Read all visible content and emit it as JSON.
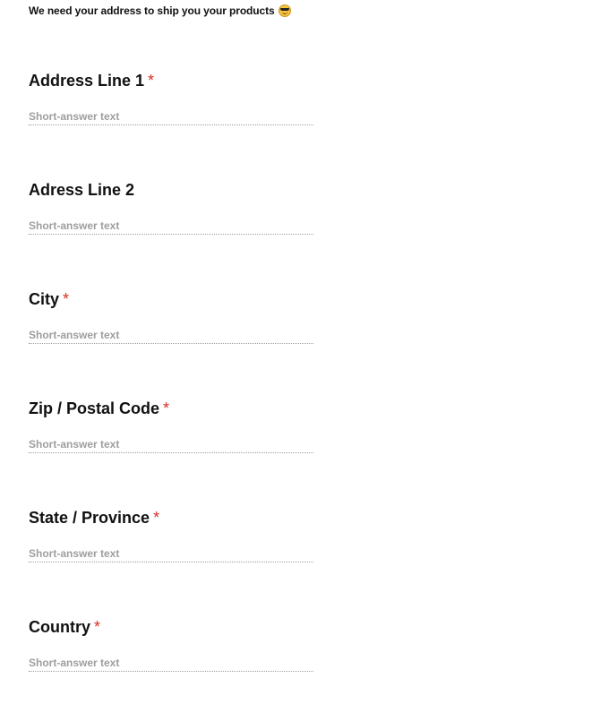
{
  "intro": {
    "text": "We need your address to ship you your products",
    "emoji_icon": "smiling-face-with-sunglasses"
  },
  "questions": [
    {
      "title": "Address Line 1",
      "required": "*",
      "placeholder": "Short-answer text",
      "value": ""
    },
    {
      "title": "Adress Line 2",
      "required": "",
      "placeholder": "Short-answer text",
      "value": ""
    },
    {
      "title": "City",
      "required": "*",
      "placeholder": "Short-answer text",
      "value": ""
    },
    {
      "title": "Zip / Postal Code",
      "required": "*",
      "placeholder": "Short-answer text",
      "value": ""
    },
    {
      "title": "State / Province",
      "required": "*",
      "placeholder": "Short-answer text",
      "value": ""
    },
    {
      "title": "Country",
      "required": "*",
      "placeholder": "Short-answer text",
      "value": ""
    }
  ],
  "colors": {
    "required_asterisk": "#d93025",
    "placeholder_text": "#9e9e9e",
    "underline": "#9aa0a6"
  }
}
